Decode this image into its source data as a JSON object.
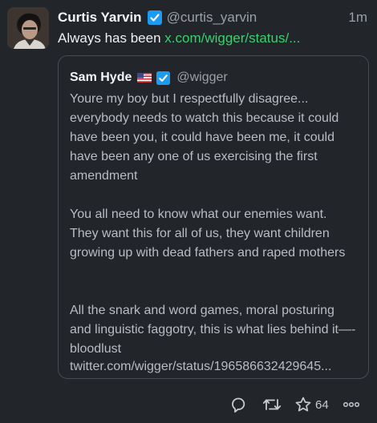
{
  "post": {
    "author_name": "Curtis Yarvin",
    "author_handle": "@curtis_yarvin",
    "time": "1m",
    "text": "Always has been",
    "link": "x.com/wigger/status/..."
  },
  "quote": {
    "author_name": "Sam Hyde",
    "author_handle": "@wigger",
    "paragraphs": [
      "Youre my boy but I respectfully disagree... everybody needs to watch this because it could have been you, it could have been me, it could have been any one of us exercising the first amendment",
      "You all need to know what our enemies want. They want this for all of us, they want children growing up with dead fathers and raped mothers",
      "All the snark and word games, moral posturing and linguistic faggotry, this is what lies behind it—-bloodlust"
    ],
    "link": "twitter.com/wigger/status/196586632429645..."
  },
  "actions": {
    "like_count": "64",
    "icons": [
      "reply-icon",
      "retweet-icon",
      "like-icon",
      "more-icon"
    ]
  },
  "colors": {
    "background": "#22252a",
    "link": "#3ccf6e",
    "verified": "#1d9bf0",
    "muted": "#9aa0a6"
  }
}
